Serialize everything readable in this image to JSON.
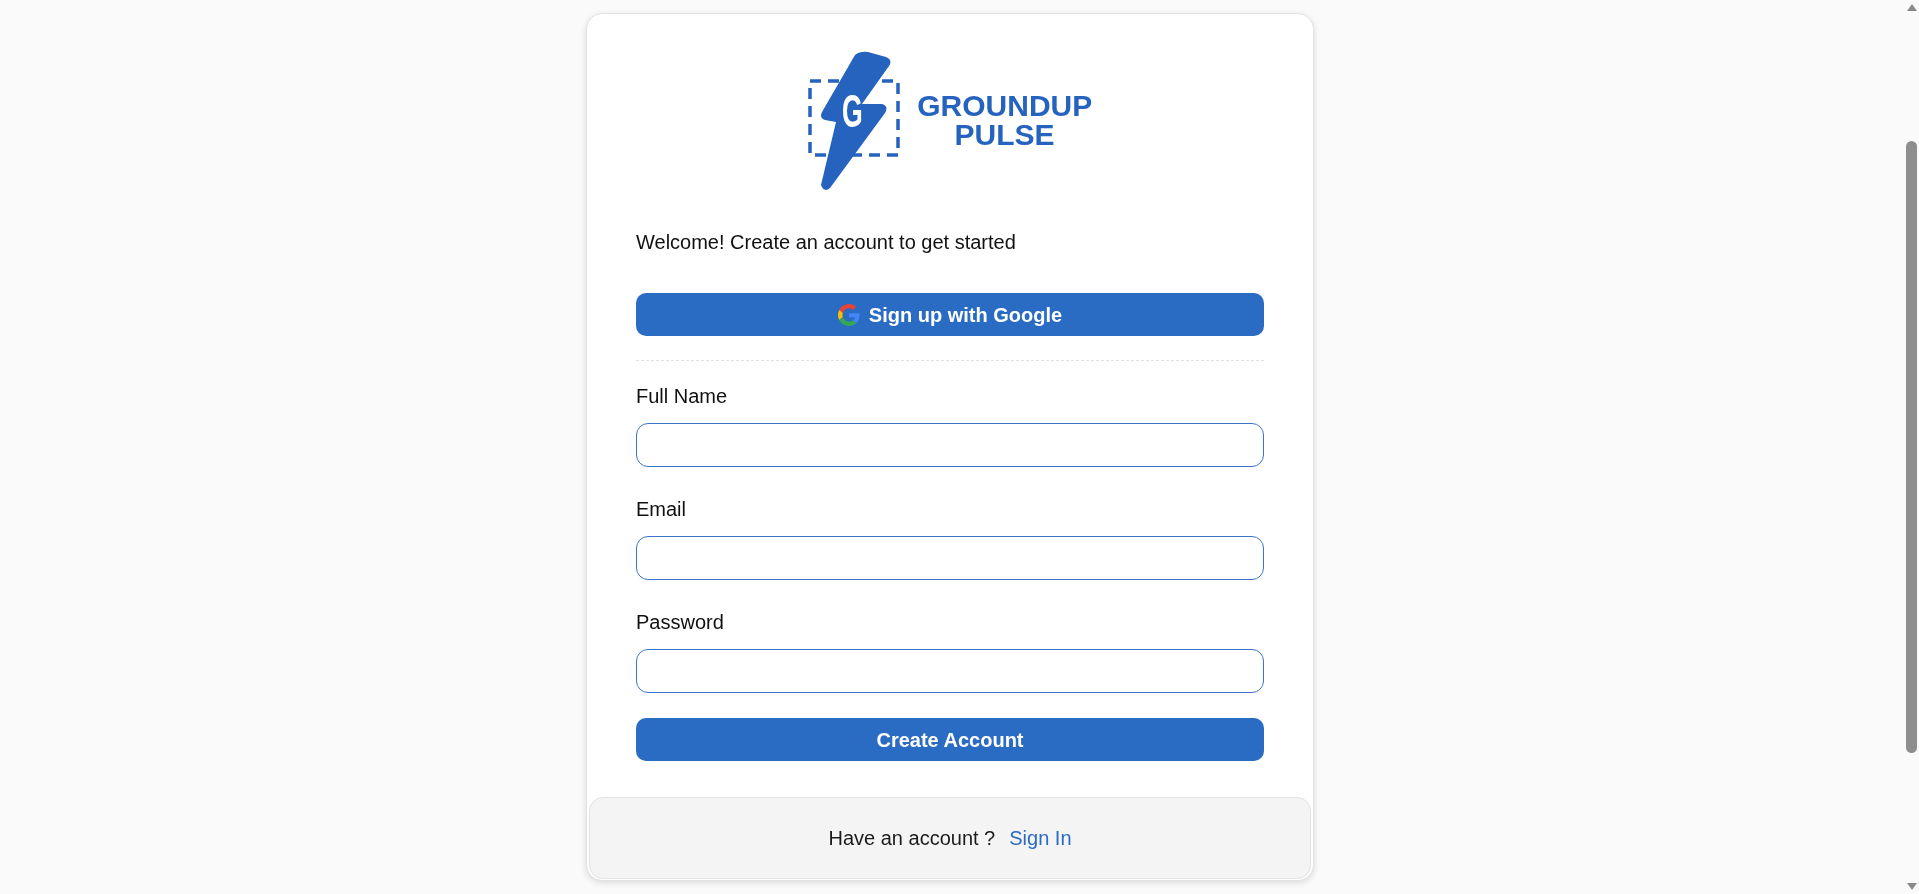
{
  "logo": {
    "mark_letter": "G",
    "wordmark": "GROUNDUP PULSE"
  },
  "intro": "Welcome! Create an account to get started",
  "google_button": {
    "label": "Sign up with Google"
  },
  "fields": [
    {
      "label": "Full Name"
    },
    {
      "label": "Email"
    },
    {
      "label": "Password"
    }
  ],
  "submit_button": {
    "label": "Create Account"
  },
  "footer": {
    "prompt": "Have an account ?",
    "link": "Sign In"
  }
}
